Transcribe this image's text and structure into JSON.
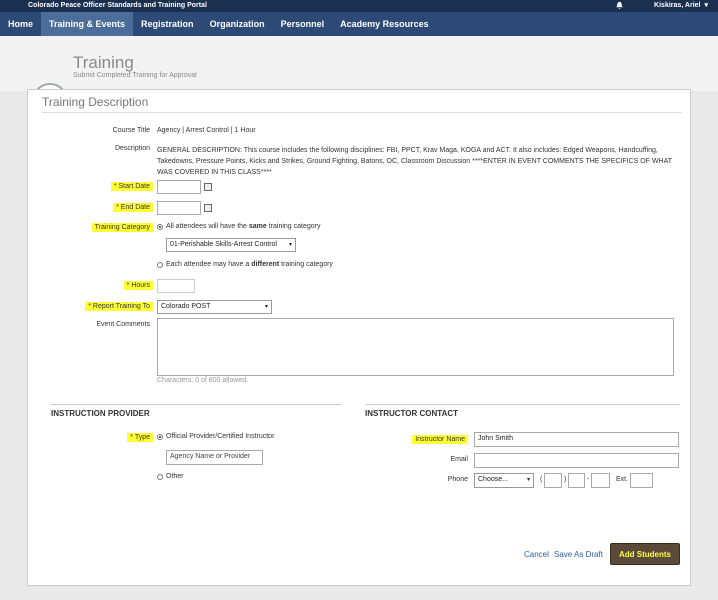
{
  "topbar": {
    "portal_name": "Colorado Peace Officer Standards and Training Portal",
    "user_name": "Kiskiras, Ariel"
  },
  "nav": {
    "items": [
      "Home",
      "Training & Events",
      "Registration",
      "Organization",
      "Personnel",
      "Academy Resources"
    ],
    "active": "Training & Events"
  },
  "header": {
    "title": "Training",
    "subtitle": "Submit Completed Training for Approval"
  },
  "form": {
    "section_title": "Training Description",
    "course_title_label": "Course Title",
    "course_title_value": "Agency | Arrest Control | 1 Hour",
    "description_label": "Description",
    "description_value": "GENERAL DESCRIPTION: This course includes the following disciplines: FBI, PPCT, Krav Maga, KOGA and ACT. It also includes: Edged Weapons, Handcuffing, Takedowns, Pressure Points, Kicks and Strikes, Ground Fighting, Batons, OC, Classroom Discussion ****ENTER IN EVENT COMMENTS THE SPECIFICS OF WHAT WAS COVERED IN THIS CLASS****",
    "start_date_label": "* Start Date",
    "end_date_label": "* End Date",
    "training_category_label": "Training Category",
    "category_option_same_pre": "All attendees will have the ",
    "category_option_same_bold": "same",
    "category_option_same_post": " training category",
    "category_select_value": "01-Perishable Skills-Arrest Control",
    "category_option_diff_pre": "Each attendee may have a ",
    "category_option_diff_bold": "different",
    "category_option_diff_post": " training category",
    "hours_label": "* Hours",
    "report_training_label": "* Report Training To",
    "report_training_value": "Colorado POST",
    "event_comments_label": "Event Comments",
    "characters_counter": "Characters: 0 of 800 allowed."
  },
  "instruction_provider": {
    "title": "INSTRUCTION PROVIDER",
    "type_label": "* Type",
    "option_official": "Official Provider/Certified Instructor",
    "agency_placeholder": "Agency Name or Provider",
    "option_other": "Other"
  },
  "instructor_contact": {
    "title": "INSTRUCTOR CONTACT",
    "name_label": "Instructor Name",
    "name_value": "John Smith",
    "email_label": "Email",
    "phone_label": "Phone",
    "phone_select": "Choose...",
    "ext_label": "Ext."
  },
  "actions": {
    "cancel": "Cancel",
    "save_draft": "Save As Draft",
    "add_students": "Add Students"
  },
  "colors": {
    "highlight": "#ffff33",
    "nav_bg": "#2c4a75",
    "topbar_bg": "#1b2f4f",
    "link": "#2a5ea8",
    "button_bg": "#5a4a3a"
  }
}
